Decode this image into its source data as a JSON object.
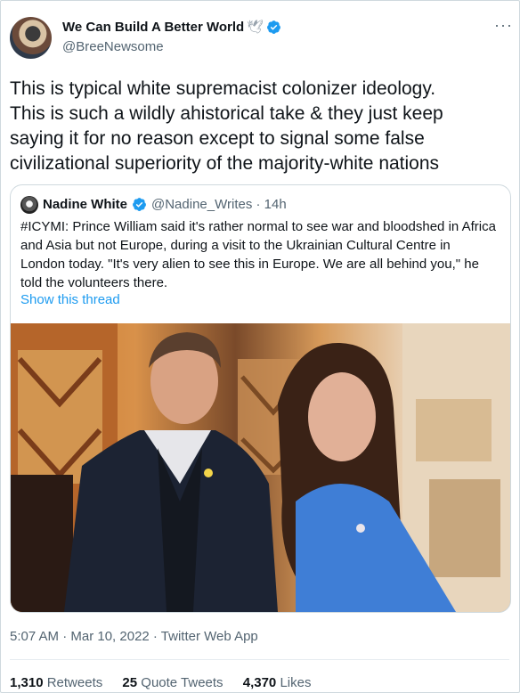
{
  "author": {
    "name": "We Can Build A Better World",
    "handle": "@BreeNewsome",
    "emoji": "🕊"
  },
  "tweet": {
    "lines": [
      "This is typical white supremacist colonizer ideology.",
      "This is such a wildly ahistorical take & they just keep",
      "saying it for no reason except to signal some false",
      "civilizational superiority of the majority-white nations"
    ]
  },
  "quote": {
    "name": "Nadine White",
    "handle_time": "@Nadine_Writes · 14h",
    "lines": [
      "#ICYMI: Prince William said it's rather normal to see war and bloodshed in Africa",
      "and Asia but not Europe, during a visit to the Ukrainian Cultural Centre in",
      "London today. \"It's very alien to see this in Europe. We are all behind you,\" he",
      "told the volunteers there."
    ],
    "show_thread": "Show this thread"
  },
  "meta": {
    "timestamp": "5:07 AM · Mar 10, 2022 · Twitter Web App"
  },
  "stats": {
    "retweets_count": "1,310",
    "retweets_label": "Retweets",
    "quotes_count": "25",
    "quotes_label": "Quote Tweets",
    "likes_count": "4,370",
    "likes_label": "Likes"
  },
  "colors": {
    "accent": "#1d9bf0",
    "secondary_text": "#536471"
  }
}
